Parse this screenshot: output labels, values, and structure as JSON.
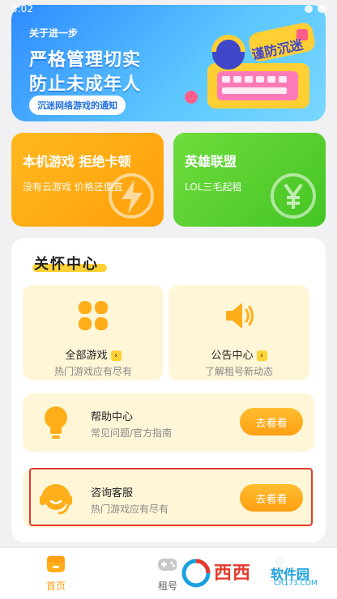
{
  "status_bar": {
    "time": "5:02"
  },
  "banner": {
    "kicker": "关于进一步",
    "line1": "严格管理切实",
    "line2": "防止未成年人",
    "notice": "沉迷网络游戏的通知",
    "badge_text": "谨防沉迷"
  },
  "promos": [
    {
      "title": "本机游戏 拒绝卡顿",
      "subtitle": "没有云游戏 价格还便宜"
    },
    {
      "title": "英雄联盟",
      "subtitle": "LOL三毛起租"
    }
  ],
  "care": {
    "title": "关怀中心",
    "tiles": [
      {
        "label": "全部游戏",
        "desc": "热门游戏应有尽有",
        "icon": "grid-icon"
      },
      {
        "label": "公告中心",
        "desc": "了解租号新动态",
        "icon": "speaker-icon"
      }
    ],
    "rows": [
      {
        "title": "帮助中心",
        "desc": "常见问题/官方指南",
        "button": "去看看",
        "icon": "lightbulb-icon"
      },
      {
        "title": "咨询客服",
        "desc": "热门游戏应有尽有",
        "button": "去看看",
        "icon": "headset-icon"
      }
    ]
  },
  "nav": [
    {
      "label": "首页",
      "active": true
    },
    {
      "label": "租号",
      "active": false
    }
  ],
  "watermark": {
    "brand": "西西",
    "site": "软件园",
    "url": "CR173.COM"
  },
  "colors": {
    "accent": "#ff9f14",
    "orange_card": "#ffb81e",
    "green_card": "#55cf2b",
    "tile_bg": "#fff6d8",
    "highlight": "#e23b2e"
  }
}
